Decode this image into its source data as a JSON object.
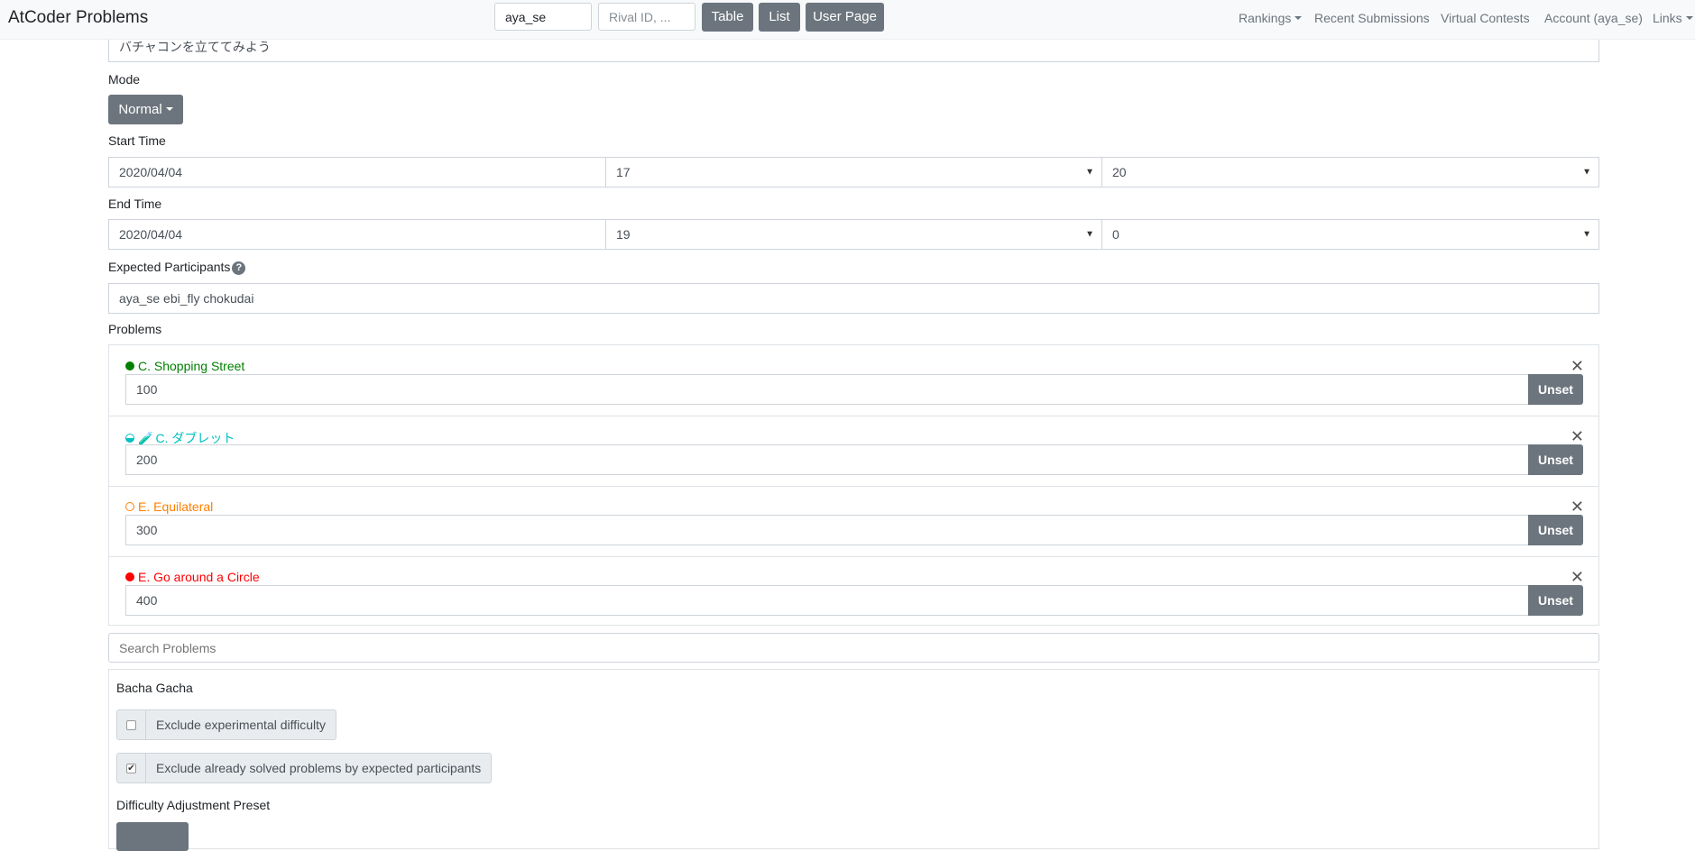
{
  "navbar": {
    "brand": "AtCoder Problems",
    "user_id_value": "aya_se",
    "rival_placeholder": "Rival ID, ...",
    "buttons": {
      "table": "Table",
      "list": "List",
      "user_page": "User Page"
    },
    "links": {
      "rankings": "Rankings",
      "recent_submissions": "Recent Submissions",
      "virtual_contests": "Virtual Contests",
      "account": "Account (aya_se)",
      "links": "Links"
    }
  },
  "form": {
    "title_value": "バチャコンを立ててみよう",
    "mode_label": "Mode",
    "mode_value": "Normal",
    "start_time_label": "Start Time",
    "start": {
      "date": "2020/04/04",
      "hour": "17",
      "minute": "20"
    },
    "end_time_label": "End Time",
    "end": {
      "date": "2020/04/04",
      "hour": "19",
      "minute": "0"
    },
    "participants_label": "Expected Participants",
    "participants_help": "?",
    "participants_value": "aya_se ebi_fly chokudai",
    "problems_label": "Problems",
    "unset_label": "Unset",
    "problems": [
      {
        "title": "C. Shopping Street",
        "point": "100",
        "color": "#008000",
        "circle": "filled",
        "experimental": false
      },
      {
        "title": "C. ダブレット",
        "point": "200",
        "color": "#00c0c0",
        "circle": "half",
        "experimental": true
      },
      {
        "title": "E. Equilateral",
        "point": "300",
        "color": "#ff8000",
        "circle": "empty",
        "experimental": false
      },
      {
        "title": "E. Go around a Circle",
        "point": "400",
        "color": "#ff0000",
        "circle": "filled",
        "experimental": false
      }
    ],
    "search_placeholder": "Search Problems"
  },
  "gacha": {
    "title": "Bacha Gacha",
    "exclude_experimental": {
      "label": "Exclude experimental difficulty",
      "checked": false
    },
    "exclude_solved": {
      "label": "Exclude already solved problems by expected participants",
      "checked": true
    },
    "preset_label": "Difficulty Adjustment Preset"
  },
  "icons": {
    "close": "close-icon",
    "dropdown": "chevron-down-icon",
    "experimental": "test-tube-icon"
  }
}
